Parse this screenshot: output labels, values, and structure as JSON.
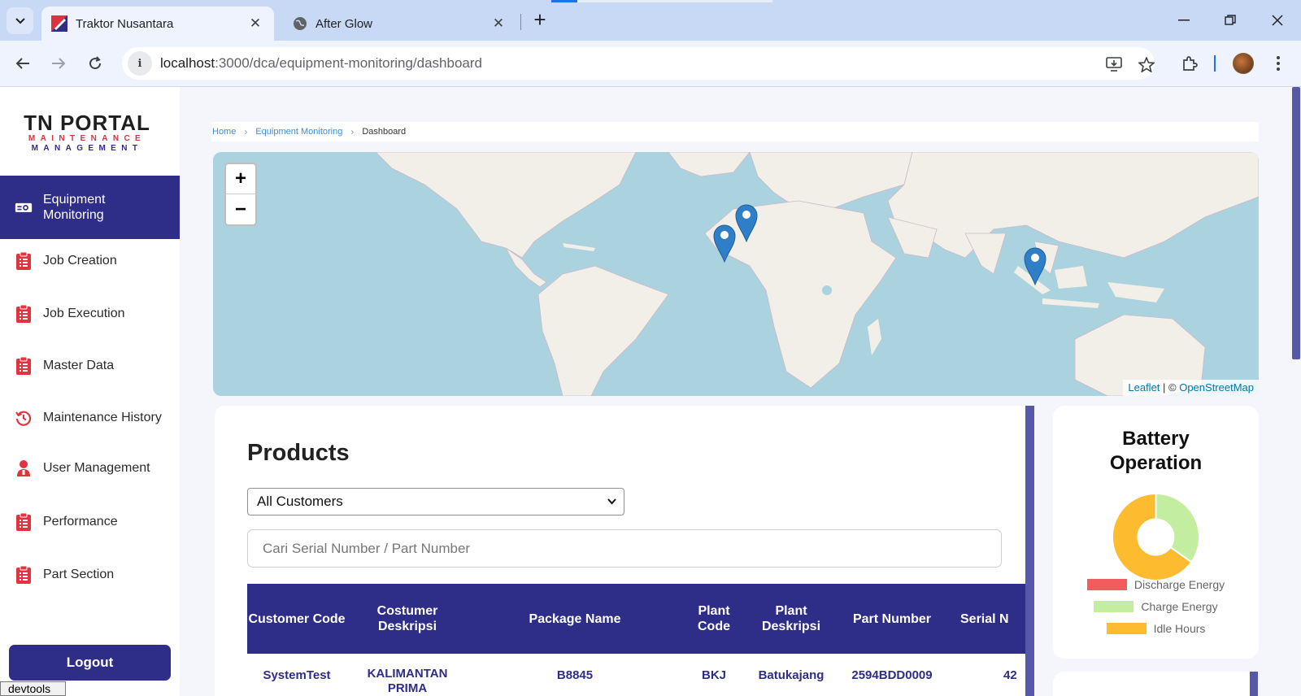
{
  "browser": {
    "tabs": [
      {
        "title": "Traktor Nusantara",
        "active": true,
        "favicon": "traktor-favicon-icon"
      },
      {
        "title": "After Glow",
        "active": false,
        "favicon": "globe-icon"
      }
    ],
    "url_host": "localhost",
    "url_path": ":3000/dca/equipment-monitoring/dashboard"
  },
  "sidebar": {
    "logo": {
      "title": "TN PORTAL",
      "line1": "MAINTENANCE",
      "line2": "MANAGEMENT"
    },
    "items": [
      {
        "label": "Equipment Monitoring",
        "icon": "monitor-icon",
        "active": true
      },
      {
        "label": "Job Creation",
        "icon": "clipboard-icon"
      },
      {
        "label": "Job Execution",
        "icon": "clipboard-icon"
      },
      {
        "label": "Master Data",
        "icon": "clipboard-icon"
      },
      {
        "label": "Maintenance History",
        "icon": "history-icon"
      },
      {
        "label": "User Management",
        "icon": "user-icon"
      },
      {
        "label": "Performance",
        "icon": "clipboard-icon"
      },
      {
        "label": "Part Section",
        "icon": "clipboard-icon"
      }
    ],
    "logout_label": "Logout",
    "devtools_label": "devtools"
  },
  "breadcrumb": {
    "home": "Home",
    "section": "Equipment Monitoring",
    "current": "Dashboard"
  },
  "map": {
    "zoom_in": "+",
    "zoom_out": "−",
    "attribution_leaflet": "Leaflet",
    "attribution_sep": " | © ",
    "attribution_osm": "OpenStreetMap"
  },
  "products": {
    "title": "Products",
    "customer_select": "All Customers",
    "search_placeholder": "Cari Serial Number / Part Number",
    "columns": [
      "Customer Code",
      "Costumer Deskripsi",
      "Package Name",
      "Plant Code",
      "Plant Deskripsi",
      "Part Number",
      "Serial N"
    ],
    "rows": [
      {
        "customer_code": "SystemTest",
        "customer_desc": "KALIMANTAN PRIMA",
        "package": "B8845",
        "plant_code": "BKJ",
        "plant_desc": "Batukajang",
        "part_number": "2594BDD0009",
        "serial": "42"
      }
    ]
  },
  "battery": {
    "title": "Battery Operation",
    "legend": [
      {
        "label": "Discharge Energy",
        "color": "#f25c5c"
      },
      {
        "label": "Charge Energy",
        "color": "#c3ed9f"
      },
      {
        "label": "Idle Hours",
        "color": "#fdbb30"
      }
    ]
  },
  "colors": {
    "primary": "#2e2d87",
    "accent": "#d9333f",
    "link": "#3a8fd6"
  }
}
